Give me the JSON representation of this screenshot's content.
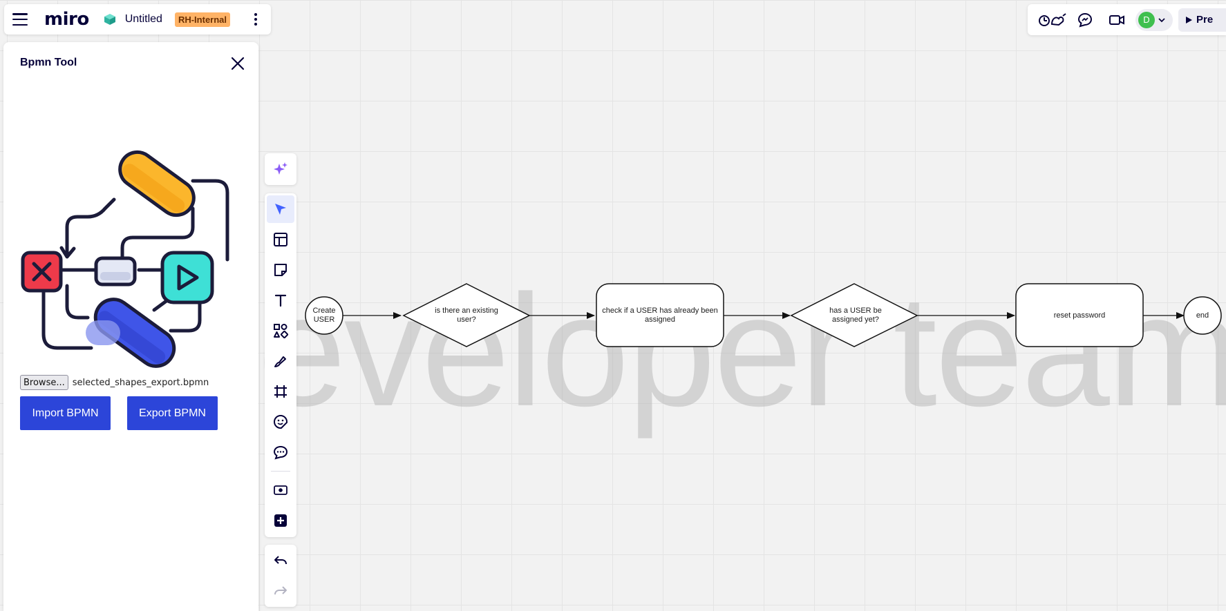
{
  "header": {
    "logo": "miro",
    "board_title": "Untitled",
    "tag": "RH-Internal",
    "present_label": "Pre",
    "avatar_initial": "D"
  },
  "panel": {
    "title": "Bpmn Tool",
    "browse_label": "Browse...",
    "file_name": "selected_shapes_export.bpmn",
    "import_label": "Import BPMN",
    "export_label": "Export BPMN"
  },
  "canvas": {
    "watermark": "developer team",
    "nodes": [
      {
        "id": "start",
        "shape": "circle",
        "label": "Create USER"
      },
      {
        "id": "gw1",
        "shape": "diamond",
        "label": "is there an existing user?"
      },
      {
        "id": "task1",
        "shape": "rounded-rect",
        "label": "check if a USER has already been assigned"
      },
      {
        "id": "gw2",
        "shape": "diamond",
        "label": "has a USER be assigned yet?"
      },
      {
        "id": "task2",
        "shape": "rounded-rect",
        "label": "reset password"
      },
      {
        "id": "end",
        "shape": "circle",
        "label": "end"
      }
    ]
  },
  "toolbar": {
    "tools": [
      "ai-assist",
      "select",
      "templates",
      "sticky-note",
      "text",
      "shapes",
      "pen",
      "frame",
      "emoji",
      "comment",
      "embed",
      "more-apps"
    ],
    "history": [
      "undo",
      "redo"
    ]
  },
  "colors": {
    "accent": "#2c45d9",
    "tag_bg": "#ffb366",
    "avatar": "#3fbf4f",
    "active_tool": "#4262ff"
  }
}
